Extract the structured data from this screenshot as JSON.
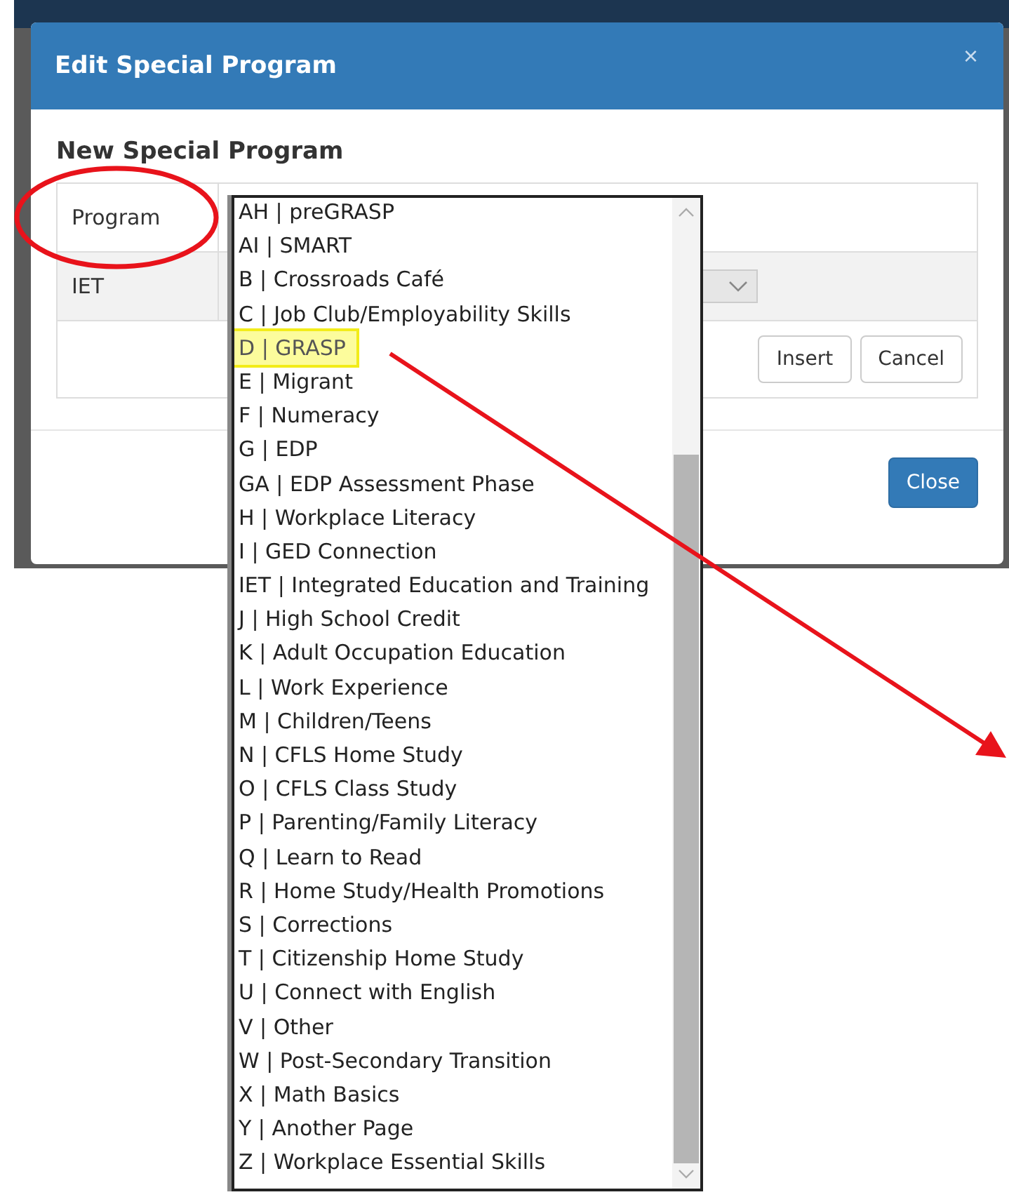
{
  "modal": {
    "title": "Edit Special Program",
    "close_symbol": "×",
    "heading": "New Special Program",
    "rows": [
      {
        "label": "Program",
        "kind": "text"
      },
      {
        "label": "IET",
        "kind": "select"
      }
    ],
    "buttons": [
      "Insert",
      "Cancel"
    ],
    "footer_button": "Close"
  },
  "dropdown": {
    "options": [
      {
        "label": "AH | preGRASP",
        "highlighted": false
      },
      {
        "label": "AI | SMART",
        "highlighted": false
      },
      {
        "label": "B | Crossroads Café",
        "highlighted": false
      },
      {
        "label": "C | Job Club/Employability Skills",
        "highlighted": false
      },
      {
        "label": "D | GRASP",
        "highlighted": true
      },
      {
        "label": "E | Migrant",
        "highlighted": false
      },
      {
        "label": "F | Numeracy",
        "highlighted": false
      },
      {
        "label": "G | EDP",
        "highlighted": false
      },
      {
        "label": "GA | EDP Assessment Phase",
        "highlighted": false
      },
      {
        "label": "H | Workplace Literacy",
        "highlighted": false
      },
      {
        "label": "I | GED Connection",
        "highlighted": false
      },
      {
        "label": "IET | Integrated Education and Training",
        "highlighted": false
      },
      {
        "label": "J | High School Credit",
        "highlighted": false
      },
      {
        "label": "K | Adult Occupation Education",
        "highlighted": false
      },
      {
        "label": "L | Work Experience",
        "highlighted": false
      },
      {
        "label": "M | Children/Teens",
        "highlighted": false
      },
      {
        "label": "N | CFLS Home Study",
        "highlighted": false
      },
      {
        "label": "O | CFLS Class Study",
        "highlighted": false
      },
      {
        "label": "P | Parenting/Family Literacy",
        "highlighted": false
      },
      {
        "label": "Q | Learn to Read",
        "highlighted": false
      },
      {
        "label": "R | Home Study/Health Promotions",
        "highlighted": false
      },
      {
        "label": "S | Corrections",
        "highlighted": false
      },
      {
        "label": "T | Citizenship Home Study",
        "highlighted": false
      },
      {
        "label": "U | Connect with English",
        "highlighted": false
      },
      {
        "label": "V | Other",
        "highlighted": false
      },
      {
        "label": "W | Post-Secondary Transition",
        "highlighted": false
      },
      {
        "label": "X | Math Basics",
        "highlighted": false
      },
      {
        "label": "Y | Another Page",
        "highlighted": false
      },
      {
        "label": "Z | Workplace Essential Skills",
        "highlighted": false
      }
    ]
  }
}
